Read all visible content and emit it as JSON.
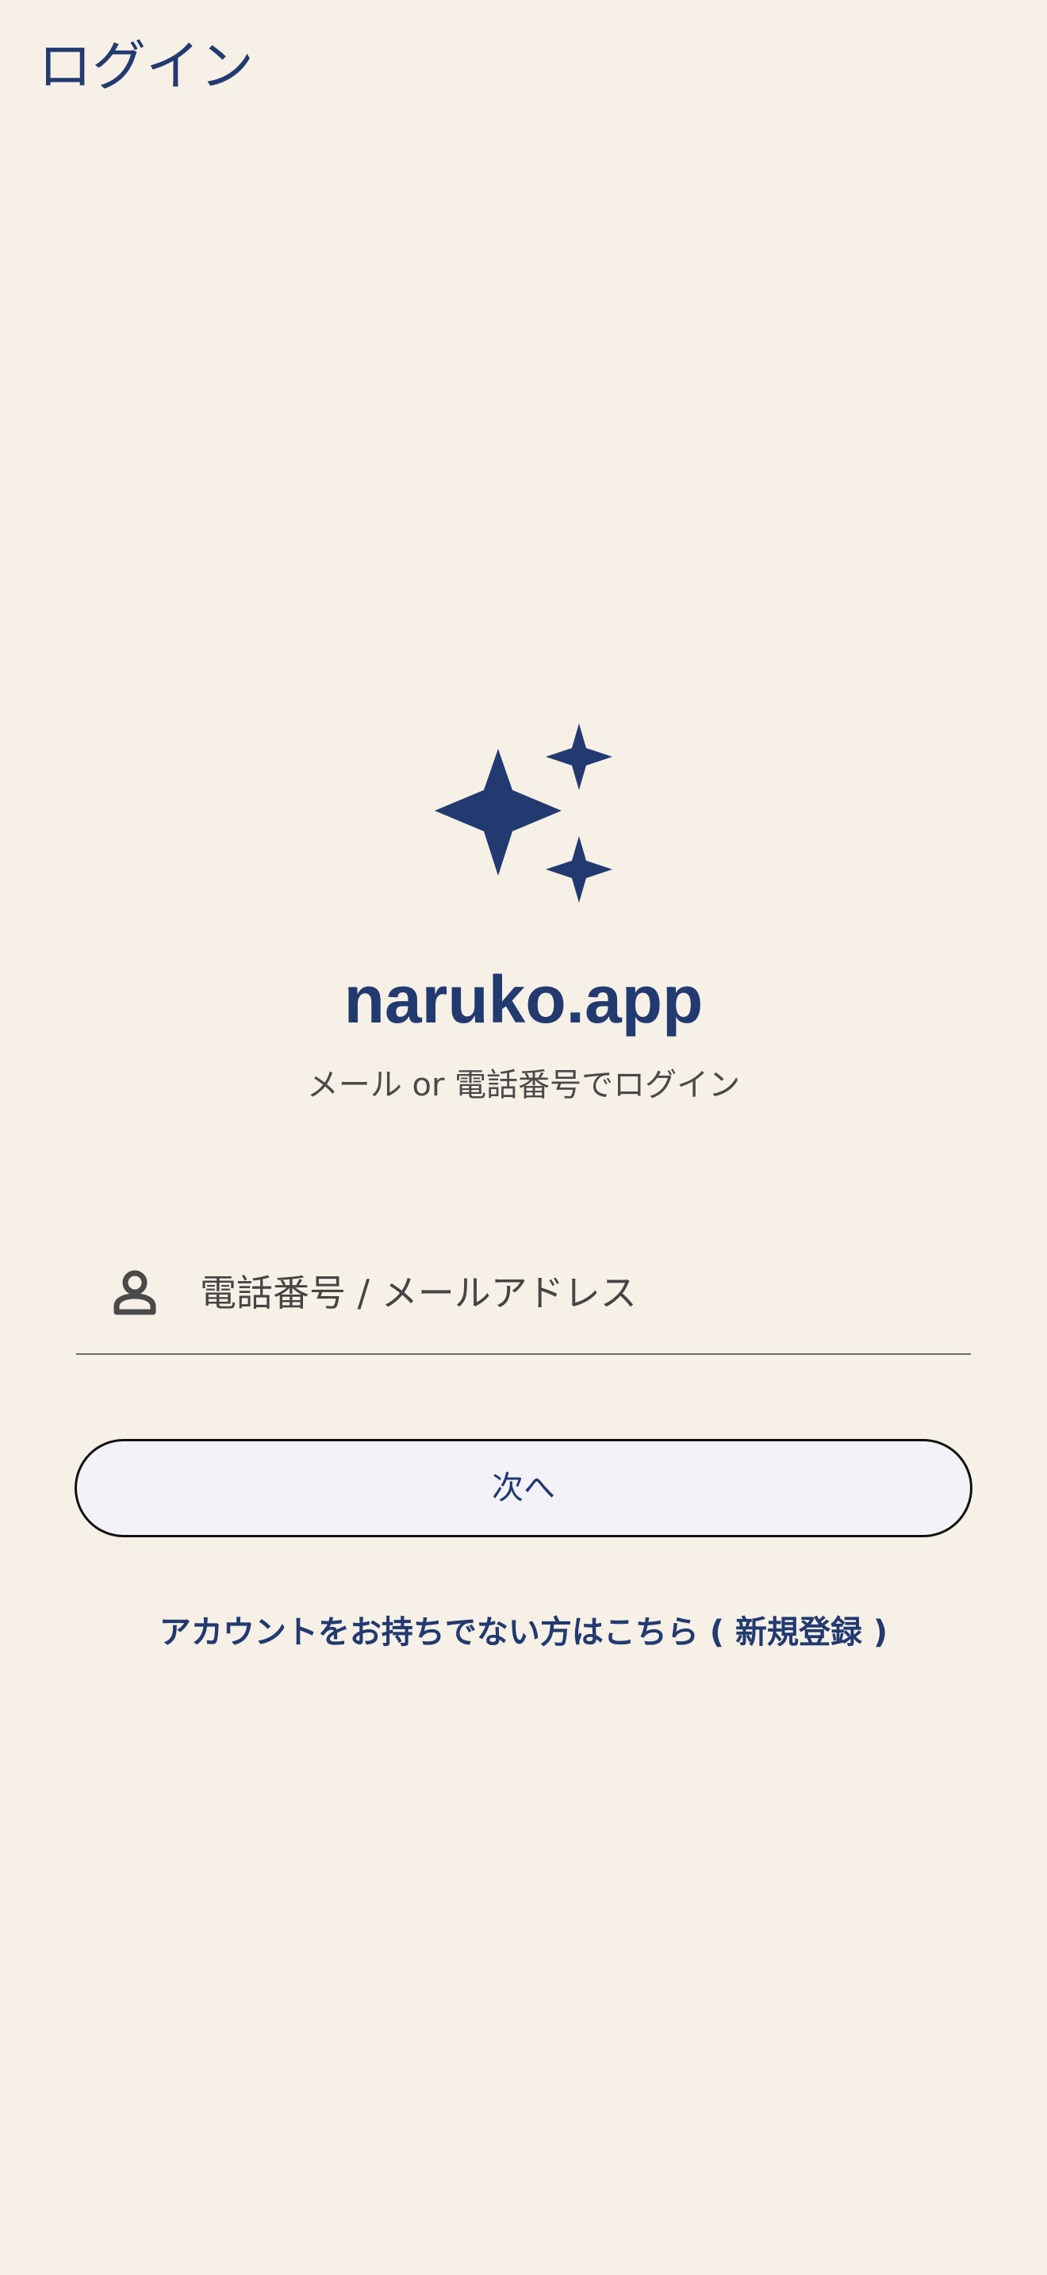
{
  "header": {
    "title": "ログイン"
  },
  "brand": {
    "logo_icon": "sparkles-icon",
    "name": "naruko.app",
    "subtitle": "メール or 電話番号でログイン",
    "accent_color": "#223a70"
  },
  "login_form": {
    "field_icon": "user-icon",
    "identifier_placeholder": "電話番号 / メールアドレス",
    "identifier_value": "",
    "next_label": "次へ"
  },
  "footer": {
    "signup_link": "アカウントをお持ちでない方はこちら ( 新規登録 )"
  },
  "colors": {
    "background": "#f6f0e6",
    "button_background": "#f2f2f8",
    "button_border": "#111111"
  }
}
